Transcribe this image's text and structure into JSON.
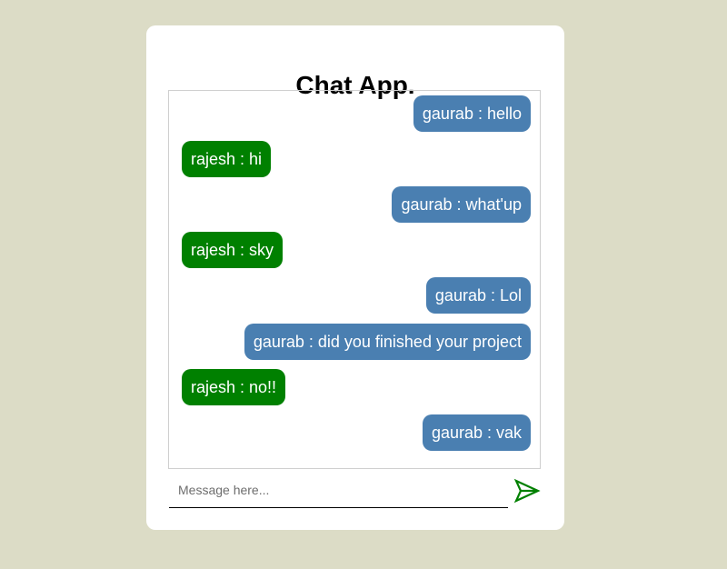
{
  "app": {
    "title": "Chat App."
  },
  "messages": [
    {
      "text": "gaurab : hello",
      "side": "out"
    },
    {
      "text": "rajesh : hi",
      "side": "in"
    },
    {
      "text": "gaurab : what'up",
      "side": "out"
    },
    {
      "text": "rajesh : sky",
      "side": "in"
    },
    {
      "text": "gaurab : Lol",
      "side": "out"
    },
    {
      "text": "gaurab : did you finished your project",
      "side": "out"
    },
    {
      "text": "rajesh : no!!",
      "side": "in"
    },
    {
      "text": "gaurab : vak",
      "side": "out"
    }
  ],
  "composer": {
    "placeholder": "Message here...",
    "value": "",
    "send_icon": "send-icon"
  },
  "colors": {
    "page_bg": "#dcdcc6",
    "outgoing_bubble": "#4a7fb1",
    "incoming_bubble": "#008000",
    "send_icon": "#008000"
  }
}
